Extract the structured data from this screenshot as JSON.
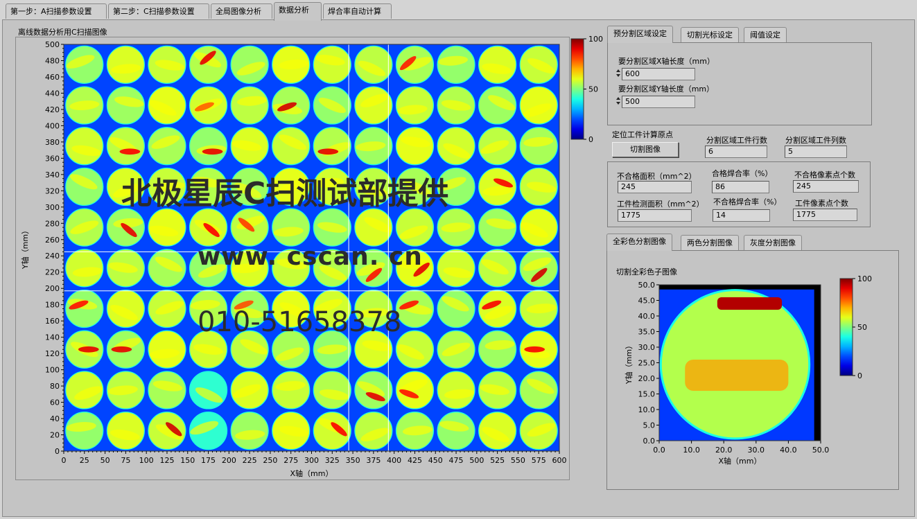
{
  "tabs": [
    "第一步：A扫描参数设置",
    "第二步：C扫描参数设置",
    "全局图像分析",
    "数据分析",
    "焊合率自动计算"
  ],
  "active_tab": 3,
  "main_plot": {
    "title": "离线数据分析用C扫描图像",
    "watermark_line1": "北极星辰C扫测试部提供",
    "watermark_line2": "www. cscan. cn",
    "watermark_line3": "010-51658378",
    "colors": {
      "background": "#0044ff",
      "accent": "#00e000"
    }
  },
  "right_tabs": [
    "预分割区域设定",
    "切割光标设定",
    "阈值设定"
  ],
  "region": {
    "x_label": "要分割区域X轴长度（mm）",
    "x_value": "600",
    "y_label": "要分割区域Y轴长度（mm）",
    "y_value": "500"
  },
  "origin_label": "定位工件计算原点",
  "cut_button": "切割图像",
  "rows_label": "分割区域工件行数",
  "rows_value": "6",
  "cols_label": "分割区域工件列数",
  "cols_value": "5",
  "stats": {
    "bad_area_label": "不合格面积（mm^2）",
    "bad_area": "245",
    "good_rate_label": "合格焊合率（%）",
    "good_rate": "86",
    "bad_pixels_label": "不合格像素点个数",
    "bad_pixels": "245",
    "test_area_label": "工件检测面积（mm^2）",
    "test_area": "1775",
    "bad_rate_label": "不合格焊合率（%）",
    "bad_rate": "14",
    "pixels_label": "工件像素点个数",
    "pixels": "1775"
  },
  "image_tabs": [
    "全彩色分割图像",
    "两色分割图像",
    "灰度分割图像"
  ],
  "sub_plot": {
    "title": "切割全彩色子图像"
  },
  "chart_data": [
    {
      "type": "heatmap",
      "title": "",
      "xlabel": "X轴（mm）",
      "ylabel": "Y轴（mm）",
      "xlim": [
        0,
        600
      ],
      "ylim": [
        0,
        500
      ],
      "x_ticks": [
        "0",
        "25",
        "50",
        "75",
        "100",
        "125",
        "150",
        "175",
        "200",
        "225",
        "250",
        "275",
        "300",
        "325",
        "350",
        "375",
        "400",
        "425",
        "450",
        "475",
        "500",
        "525",
        "550",
        "575",
        "600"
      ],
      "y_ticks": [
        "0",
        "20",
        "40",
        "60",
        "80",
        "100",
        "120",
        "140",
        "160",
        "180",
        "200",
        "220",
        "240",
        "260",
        "280",
        "300",
        "320",
        "340",
        "360",
        "380",
        "400",
        "420",
        "440",
        "460",
        "480",
        "500"
      ],
      "colorbar": {
        "range": [
          0,
          100
        ],
        "ticks": [
          "0",
          "50",
          "100"
        ]
      },
      "grid_cols": 12,
      "grid_rows": 10,
      "cursor_x": [
        345,
        393
      ],
      "cursor_y": [
        197,
        245
      ],
      "defect_spots": [
        {
          "col": 3,
          "row": 0,
          "v": 90
        },
        {
          "col": 8,
          "row": 0,
          "v": 85
        },
        {
          "col": 5,
          "row": 1,
          "v": 92
        },
        {
          "col": 3,
          "row": 1,
          "v": 78
        },
        {
          "col": 1,
          "row": 2,
          "v": 88
        },
        {
          "col": 3,
          "row": 2,
          "v": 90
        },
        {
          "col": 6,
          "row": 2,
          "v": 90
        },
        {
          "col": 10,
          "row": 3,
          "v": 88
        },
        {
          "col": 1,
          "row": 4,
          "v": 90
        },
        {
          "col": 3,
          "row": 4,
          "v": 88
        },
        {
          "col": 4,
          "row": 4,
          "v": 82
        },
        {
          "col": 7,
          "row": 5,
          "v": 86
        },
        {
          "col": 8,
          "row": 5,
          "v": 90
        },
        {
          "col": 11,
          "row": 5,
          "v": 92
        },
        {
          "col": 0,
          "row": 6,
          "v": 86
        },
        {
          "col": 4,
          "row": 6,
          "v": 80
        },
        {
          "col": 8,
          "row": 6,
          "v": 86
        },
        {
          "col": 10,
          "row": 6,
          "v": 88
        },
        {
          "col": 0,
          "row": 7,
          "v": 90
        },
        {
          "col": 1,
          "row": 7,
          "v": 90
        },
        {
          "col": 11,
          "row": 7,
          "v": 88
        },
        {
          "col": 7,
          "row": 8,
          "v": 90
        },
        {
          "col": 8,
          "row": 8,
          "v": 86
        },
        {
          "col": 2,
          "row": 9,
          "v": 92
        },
        {
          "col": 6,
          "row": 9,
          "v": 88
        }
      ],
      "cyan_parts": [
        {
          "col": 3,
          "row": 8
        },
        {
          "col": 3,
          "row": 9
        }
      ]
    },
    {
      "type": "heatmap",
      "title": "",
      "xlabel": "X轴（mm）",
      "ylabel": "Y轴（mm）",
      "xlim": [
        0,
        50
      ],
      "ylim": [
        0,
        50
      ],
      "x_ticks": [
        "0.0",
        "10.0",
        "20.0",
        "30.0",
        "40.0",
        "50.0"
      ],
      "y_ticks": [
        "0.0",
        "5.0",
        "10.0",
        "15.0",
        "20.0",
        "25.0",
        "30.0",
        "35.0",
        "40.0",
        "45.0",
        "50.0"
      ],
      "colorbar": {
        "range": [
          0,
          100
        ],
        "ticks": [
          "0",
          "50",
          "100"
        ]
      },
      "part_center": [
        23.5,
        24.5
      ],
      "part_radius": 23,
      "defect_band": {
        "x": [
          18,
          38
        ],
        "y": [
          42,
          46
        ],
        "v": 95
      },
      "warm_band": {
        "x": [
          8,
          40
        ],
        "y": [
          16,
          26
        ],
        "v": 72
      }
    }
  ]
}
